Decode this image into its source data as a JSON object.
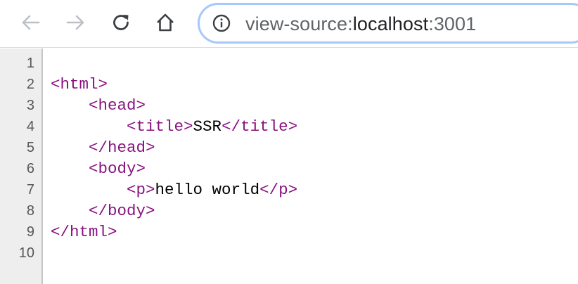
{
  "toolbar": {
    "back_icon": "back-arrow-icon",
    "forward_icon": "forward-arrow-icon",
    "reload_icon": "reload-icon",
    "home_icon": "home-icon",
    "info_icon": "info-icon",
    "url_scheme": "view-source:",
    "url_host": "localhost",
    "url_port": ":3001"
  },
  "gutter": {
    "line_numbers": [
      "1",
      "2",
      "3",
      "4",
      "5",
      "6",
      "7",
      "8",
      "9",
      "10"
    ]
  },
  "source": {
    "lines": [
      {
        "indent": "",
        "open": "",
        "text": "",
        "close": ""
      },
      {
        "indent": "",
        "open": "<html>",
        "text": "",
        "close": ""
      },
      {
        "indent": "    ",
        "open": "<head>",
        "text": "",
        "close": ""
      },
      {
        "indent": "        ",
        "open": "<title>",
        "text": "SSR",
        "close": "</title>"
      },
      {
        "indent": "    ",
        "open": "</head>",
        "text": "",
        "close": ""
      },
      {
        "indent": "    ",
        "open": "<body>",
        "text": "",
        "close": ""
      },
      {
        "indent": "        ",
        "open": "<p>",
        "text": "hello world",
        "close": "</p>"
      },
      {
        "indent": "    ",
        "open": "</body>",
        "text": "",
        "close": ""
      },
      {
        "indent": "",
        "open": "</html>",
        "text": "",
        "close": ""
      },
      {
        "indent": "",
        "open": "",
        "text": "",
        "close": ""
      }
    ]
  },
  "colors": {
    "tag": "#881280",
    "text": "#000000",
    "gutter_bg": "#eeeeee",
    "omnibox_border": "#a8c7fa"
  }
}
